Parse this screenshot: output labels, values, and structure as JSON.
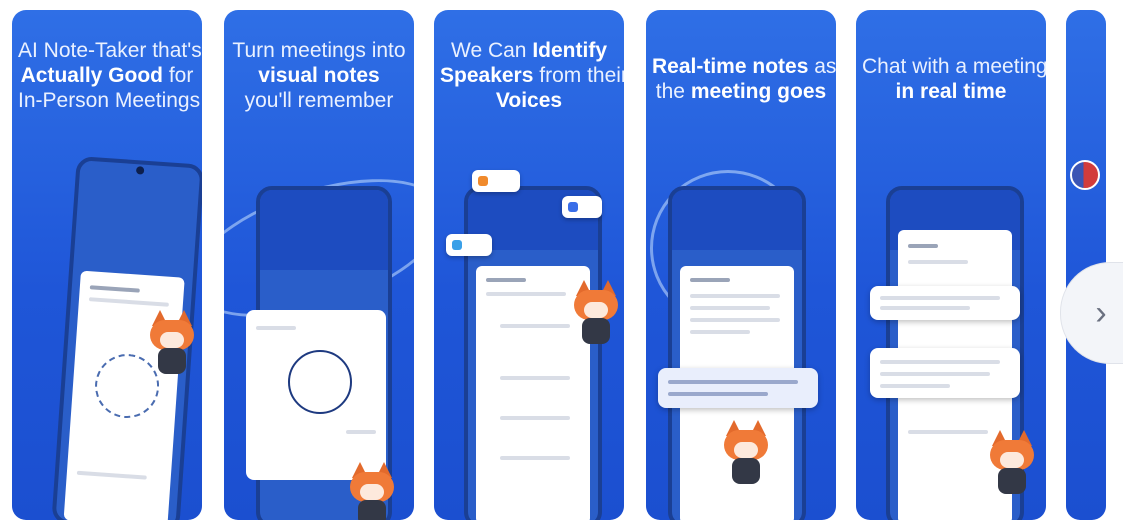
{
  "screenshots": [
    {
      "title_lines": [
        {
          "parts": [
            {
              "text": "AI Note-Taker that's",
              "bold": false
            }
          ]
        },
        {
          "parts": [
            {
              "text": "Actually Good",
              "bold": true
            },
            {
              "text": " for",
              "bold": false
            }
          ]
        },
        {
          "parts": [
            {
              "text": "In-Person Meetings",
              "bold": false
            }
          ]
        }
      ]
    },
    {
      "title_lines": [
        {
          "parts": [
            {
              "text": "Turn meetings into",
              "bold": false
            }
          ]
        },
        {
          "parts": [
            {
              "text": "visual notes",
              "bold": true
            }
          ]
        },
        {
          "parts": [
            {
              "text": "you'll remember",
              "bold": false
            }
          ]
        }
      ]
    },
    {
      "title_lines": [
        {
          "parts": [
            {
              "text": "We Can ",
              "bold": false
            },
            {
              "text": "Identify",
              "bold": true
            }
          ]
        },
        {
          "parts": [
            {
              "text": "Speakers",
              "bold": true
            },
            {
              "text": " from their",
              "bold": false
            }
          ]
        },
        {
          "parts": [
            {
              "text": "Voices",
              "bold": true
            }
          ]
        }
      ]
    },
    {
      "title_lines": [
        {
          "parts": [
            {
              "text": "Real-time notes",
              "bold": true
            },
            {
              "text": " as",
              "bold": false
            }
          ]
        },
        {
          "parts": [
            {
              "text": "the ",
              "bold": false
            },
            {
              "text": "meeting goes",
              "bold": true
            }
          ]
        }
      ]
    },
    {
      "title_lines": [
        {
          "parts": [
            {
              "text": "Chat with a meeting",
              "bold": false
            }
          ]
        },
        {
          "parts": [
            {
              "text": "in real time",
              "bold": true
            }
          ]
        }
      ]
    }
  ],
  "next_button": {
    "label": "›"
  },
  "colors": {
    "card_blue": "#2f6fe6",
    "mascot_orange": "#f07a38"
  }
}
